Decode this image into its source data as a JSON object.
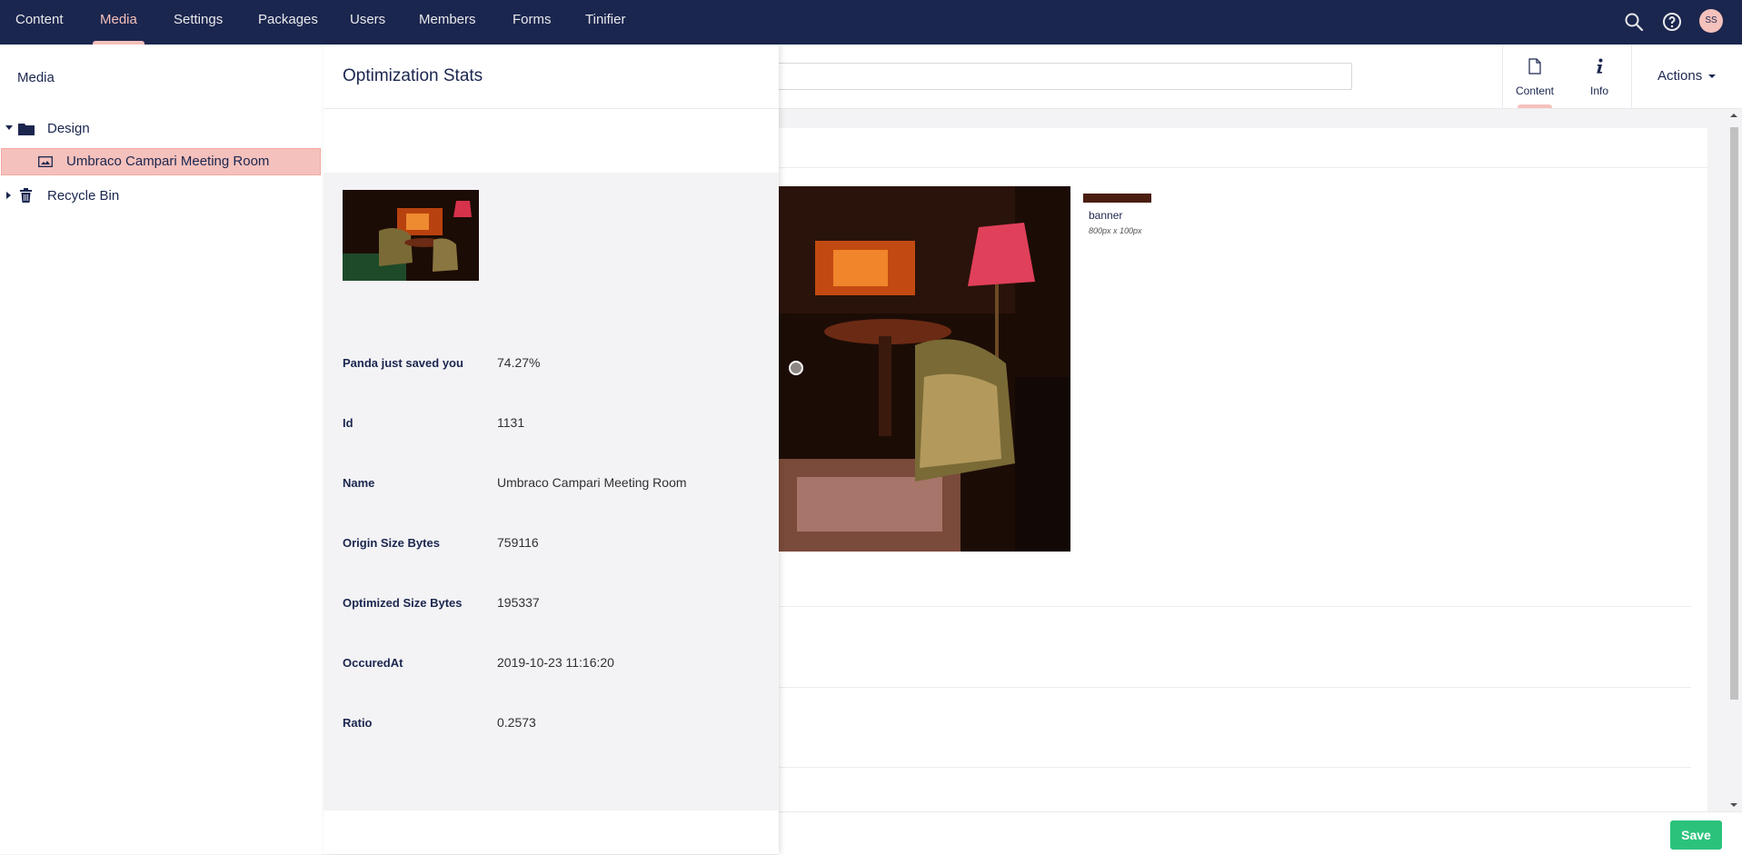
{
  "nav": {
    "items": [
      {
        "label": "Content",
        "active": false
      },
      {
        "label": "Media",
        "active": true
      },
      {
        "label": "Settings",
        "active": false
      },
      {
        "label": "Packages",
        "active": false
      },
      {
        "label": "Users",
        "active": false
      },
      {
        "label": "Members",
        "active": false
      },
      {
        "label": "Forms",
        "active": false
      },
      {
        "label": "Tinifier",
        "active": false
      }
    ],
    "user_initials": "SS",
    "icons": [
      "search-icon",
      "help-icon"
    ]
  },
  "tree": {
    "title": "Media",
    "items": [
      {
        "label": "Design",
        "icon": "folder-icon",
        "expanded": true
      },
      {
        "label": "Umbraco Campari Meeting Room",
        "icon": "image-icon",
        "selected": true
      },
      {
        "label": "Recycle Bin",
        "icon": "trash-icon",
        "expanded": false
      }
    ]
  },
  "overlay": {
    "title": "Optimization Stats",
    "stats": [
      {
        "label": "Panda just saved you",
        "value": "74.27%"
      },
      {
        "label": "Id",
        "value": "1131"
      },
      {
        "label": "Name",
        "value": "Umbraco Campari Meeting Room"
      },
      {
        "label": "Origin Size Bytes",
        "value": "759116"
      },
      {
        "label": "Optimized Size Bytes",
        "value": "195337"
      },
      {
        "label": "OccuredAt",
        "value": "2019-10-23 11:16:20"
      },
      {
        "label": "Ratio",
        "value": "0.2573"
      }
    ]
  },
  "editor": {
    "apps": [
      {
        "label": "Content",
        "icon": "document-icon",
        "active": true
      },
      {
        "label": "Info",
        "icon": "info-icon",
        "active": false
      }
    ],
    "actions_label": "Actions",
    "crop": {
      "name": "banner",
      "size": "800px x 100px"
    },
    "save_label": "Save"
  },
  "colors": {
    "nav_bg": "#1b264f",
    "accent": "#f5c1bc",
    "save": "#2bc37c"
  }
}
